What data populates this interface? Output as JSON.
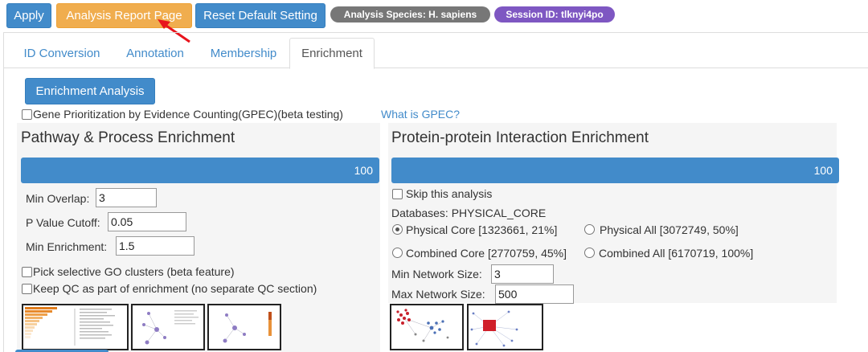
{
  "toolbar": {
    "apply_label": "Apply",
    "report_label": "Analysis Report Page",
    "reset_label": "Reset Default Setting",
    "species_badge": "Analysis Species: H. sapiens",
    "session_badge": "Session ID: tlknyi4po"
  },
  "tabs": [
    {
      "label": "ID Conversion"
    },
    {
      "label": "Annotation"
    },
    {
      "label": "Membership"
    },
    {
      "label": "Enrichment"
    }
  ],
  "enrichment": {
    "button_label": "Enrichment Analysis",
    "gpec_label": "Gene Prioritization by Evidence Counting(GPEC)(beta testing)",
    "gpec_link": "What is GPEC?"
  },
  "pathway": {
    "title": "Pathway & Process Enrichment",
    "progress_value": 100,
    "progress_text": "100",
    "min_overlap_label": "Min Overlap:",
    "min_overlap_value": "3",
    "pvalue_label": "P Value Cutoff:",
    "pvalue_value": "0.05",
    "min_enrichment_label": "Min Enrichment:",
    "min_enrichment_value": "1.5",
    "go_clusters_label": "Pick selective GO clusters (beta feature)",
    "keep_qc_label": "Keep QC as part of enrichment (no separate QC section)"
  },
  "ppi": {
    "title": "Protein-protein Interaction Enrichment",
    "progress_value": 100,
    "progress_text": "100",
    "skip_label": "Skip this analysis",
    "databases_label": "Databases: PHYSICAL_CORE",
    "options": [
      {
        "label": "Physical Core [1323661, 21%]",
        "checked": true
      },
      {
        "label": "Physical All [3072749, 50%]",
        "checked": false
      },
      {
        "label": "Combined Core [2770759, 45%]",
        "checked": false
      },
      {
        "label": "Combined All [6170719, 100%]",
        "checked": false
      }
    ],
    "min_network_label": "Min Network Size:",
    "min_network_value": "3",
    "max_network_label": "Max Network Size:",
    "max_network_value": "500"
  },
  "colors": {
    "primary": "#428bca",
    "warning": "#f0ad4e",
    "badge_gray": "#777777",
    "badge_purple": "#7e57c2",
    "arrow": "#e8141c"
  }
}
